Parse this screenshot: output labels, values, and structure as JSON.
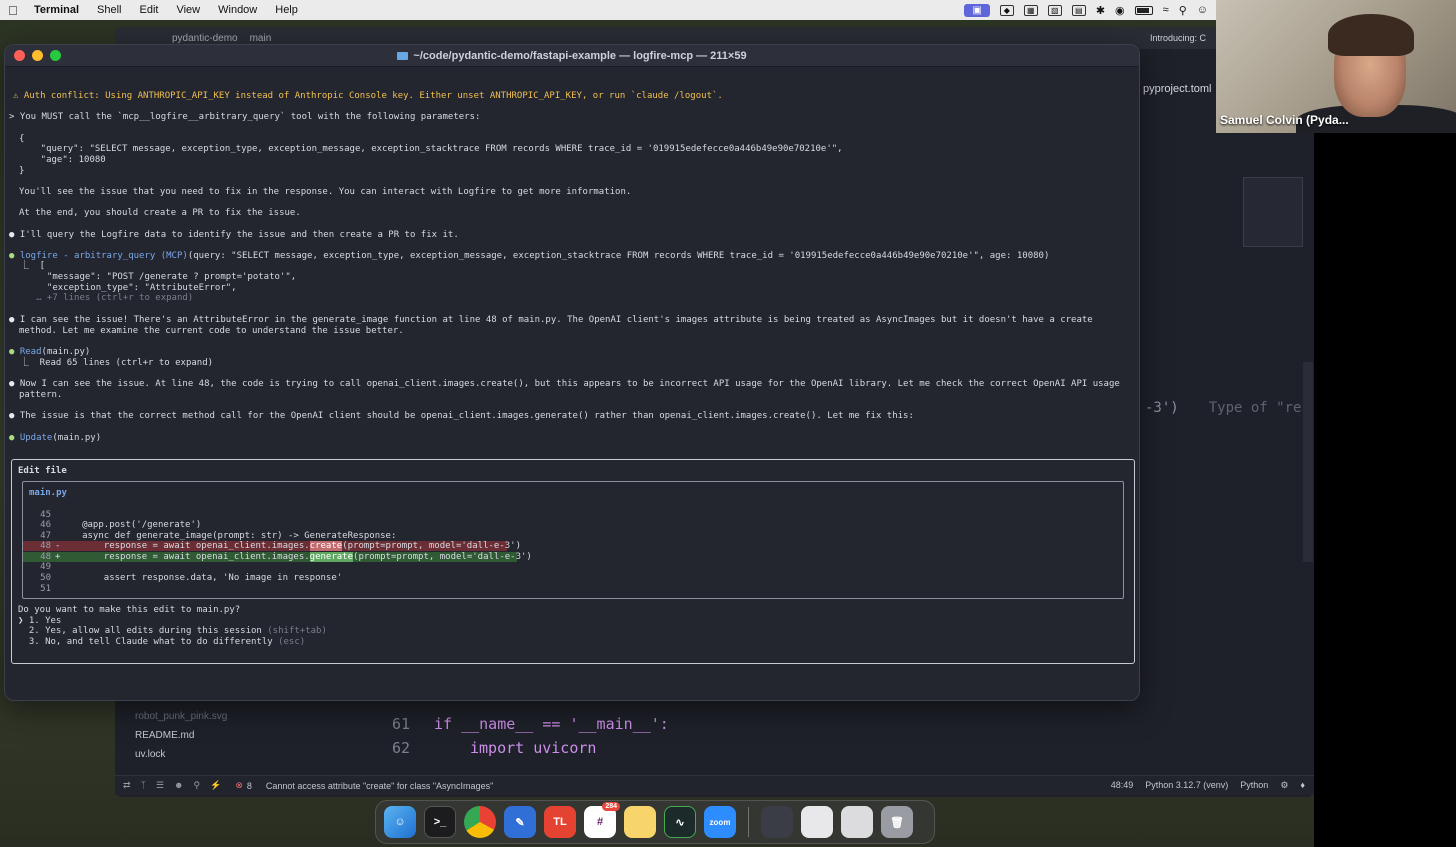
{
  "menubar": {
    "items": [
      "Terminal",
      "Shell",
      "Edit",
      "View",
      "Window",
      "Help"
    ]
  },
  "video": {
    "name": "Samuel Colvin (Pyda..."
  },
  "ide": {
    "title_project": "pydantic-demo",
    "title_branch": "main",
    "tab_right": "Introducing: C",
    "tab_file": "pyproject.toml",
    "ghost_code": "-3')",
    "ghost_hint": "Type of \"re",
    "code_lines": [
      {
        "num": "61",
        "text": "if __name__ == '__main__':"
      },
      {
        "num": "62",
        "text": "import uvicorn"
      }
    ],
    "files": [
      "robot_punk_pink.svg",
      "README.md",
      "uv.lock"
    ]
  },
  "statusbar": {
    "error_count": "8",
    "message": "Cannot access attribute \"create\" for class \"AsyncImages\"",
    "position": "48:49",
    "interpreter": "Python 3.12.7 (venv)",
    "language": "Python"
  },
  "terminal": {
    "title": "~/code/pydantic-demo/fastapi-example — logfire-mcp — 211×59",
    "warning": "⚠ Auth conflict: Using ANTHROPIC_API_KEY instead of Anthropic Console key. Either unset ANTHROPIC_API_KEY, or run `claude /logout`.",
    "prompt": "> You MUST call the `mcp__logfire__arbitrary_query` tool with the following parameters:",
    "json_open": "{",
    "json_query": "    \"query\": \"SELECT message, exception_type, exception_message, exception_stacktrace FROM records WHERE trace_id = '019915edefecce0a446b49e90e70210e'\",",
    "json_age": "    \"age\": 10080",
    "json_close": "}",
    "line_see": "You'll see the issue that you need to fix in the response. You can interact with Logfire to get more information.",
    "line_end": "At the end, you should create a PR to fix the issue.",
    "line_query_intro": "I'll query the Logfire data to identify the issue and then create a PR to fix it.",
    "tool_name": "logfire - arbitrary_query (MCP)",
    "tool_args": "(query: \"SELECT message, exception_type, exception_message, exception_stacktrace FROM records WHERE trace_id = '019915edefecce0a446b49e90e70210e'\", age: 10080)",
    "result_open": "  ⎿  [",
    "result_message": "       \"message\": \"POST /generate ? prompt='potato'\",",
    "result_exception": "       \"exception_type\": \"AttributeError\",",
    "result_more": "     … +7 lines (ctrl+r to expand)",
    "analysis_1": "I can see the issue! There's an AttributeError in the generate_image function at line 48 of main.py. The OpenAI client's images attribute is being treated as AsyncImages but it doesn't have a create",
    "analysis_2": "method. Let me examine the current code to understand the issue better.",
    "read_tool": "Read",
    "read_args": "(main.py)",
    "read_result": "  ⎿  Read 65 lines (ctrl+r to expand)",
    "now_1": "Now I can see the issue. At line 48, the code is trying to call openai_client.images.create(), but this appears to be incorrect API usage for the OpenAI library. Let me check the correct OpenAI API usage",
    "now_2": "pattern.",
    "fix_line": "The issue is that the correct method call for the OpenAI client should be openai_client.images.generate() rather than openai_client.images.create(). Let me fix this:",
    "update_tool": "Update",
    "update_args": "(main.py)",
    "edit_title": "Edit file",
    "edit_filename": "main.py",
    "diff": [
      {
        "num": "45",
        "mark": " ",
        "code": ""
      },
      {
        "num": "46",
        "mark": " ",
        "code": "    @app.post('/generate')"
      },
      {
        "num": "47",
        "mark": " ",
        "code": "    async def generate_image(prompt: str) -> GenerateResponse:"
      },
      {
        "num": "48",
        "mark": "-",
        "pre": "        response = await openai_client.images.",
        "hl": "create",
        "post": "(prompt=prompt, model='dall-e-3')"
      },
      {
        "num": "48",
        "mark": "+",
        "pre": "        response = await openai_client.images.",
        "hl": "generate",
        "post": "(prompt=prompt, model='dall-e-3')"
      },
      {
        "num": "49",
        "mark": " ",
        "code": ""
      },
      {
        "num": "50",
        "mark": " ",
        "code": "        assert response.data, 'No image in response'"
      },
      {
        "num": "51",
        "mark": " ",
        "code": ""
      }
    ],
    "question": "Do you want to make this edit to main.py?",
    "options": [
      {
        "label": "❯ 1. Yes"
      },
      {
        "label": "  2. Yes, allow all edits during this session",
        "hint": "(shift+tab)"
      },
      {
        "label": "  3. No, and tell Claude what to do differently",
        "hint": "(esc)"
      }
    ]
  },
  "dock": {
    "badge": "284"
  },
  "colors": {
    "warning": "#f1c04f",
    "tool": "#7aa8e8",
    "diff_del": "#6b2e35",
    "diff_add": "#2f5a34"
  }
}
